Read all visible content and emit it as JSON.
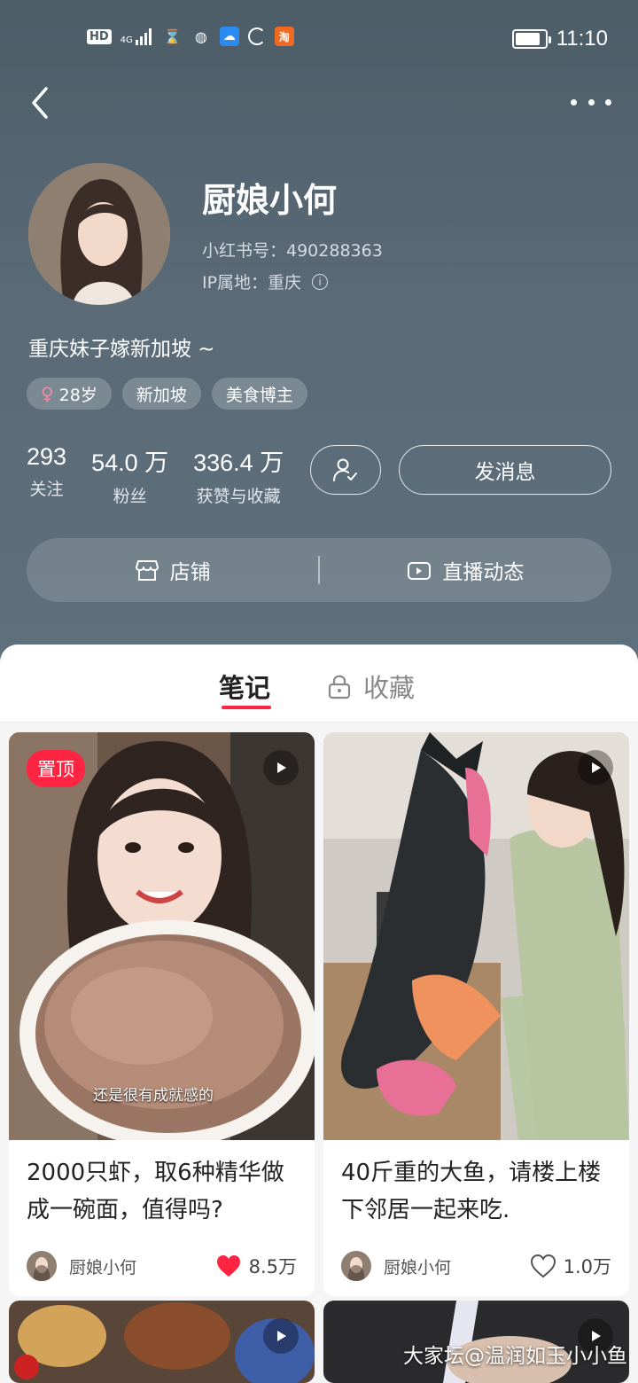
{
  "status_bar": {
    "network": "HD",
    "signal": "4G",
    "time": "11:10",
    "battery_level": 0.85
  },
  "profile": {
    "name": "厨娘小何",
    "id_text": "小红书号：490288363",
    "ip_text": "IP属地：重庆",
    "bio": "重庆妹子嫁新加坡 ~",
    "tags": {
      "age": "28岁",
      "location": "新加坡",
      "category": "美食博主"
    },
    "stats": {
      "following": {
        "num": "293",
        "label": "关注"
      },
      "followers": {
        "num": "54.0 万",
        "label": "粉丝"
      },
      "likes": {
        "num": "336.4 万",
        "label": "获赞与收藏"
      }
    },
    "message_label": "发消息",
    "shop_label": "店铺",
    "live_label": "直播动态"
  },
  "tabs": {
    "notes": "笔记",
    "favorites": "收藏"
  },
  "cards": [
    {
      "pin": "置顶",
      "caption": "还是很有成就感的",
      "title": "2000只虾，取6种精华做成一碗面，值得吗?",
      "author": "厨娘小何",
      "likes": "8.5万",
      "liked": true
    },
    {
      "title": "40斤重的大鱼，请楼上楼下邻居一起来吃.",
      "author": "厨娘小何",
      "likes": "1.0万",
      "liked": false
    }
  ],
  "watermark": "大家坛@温润如玉小小鱼",
  "colors": {
    "header": "#56676f",
    "accent": "#ff2442"
  }
}
